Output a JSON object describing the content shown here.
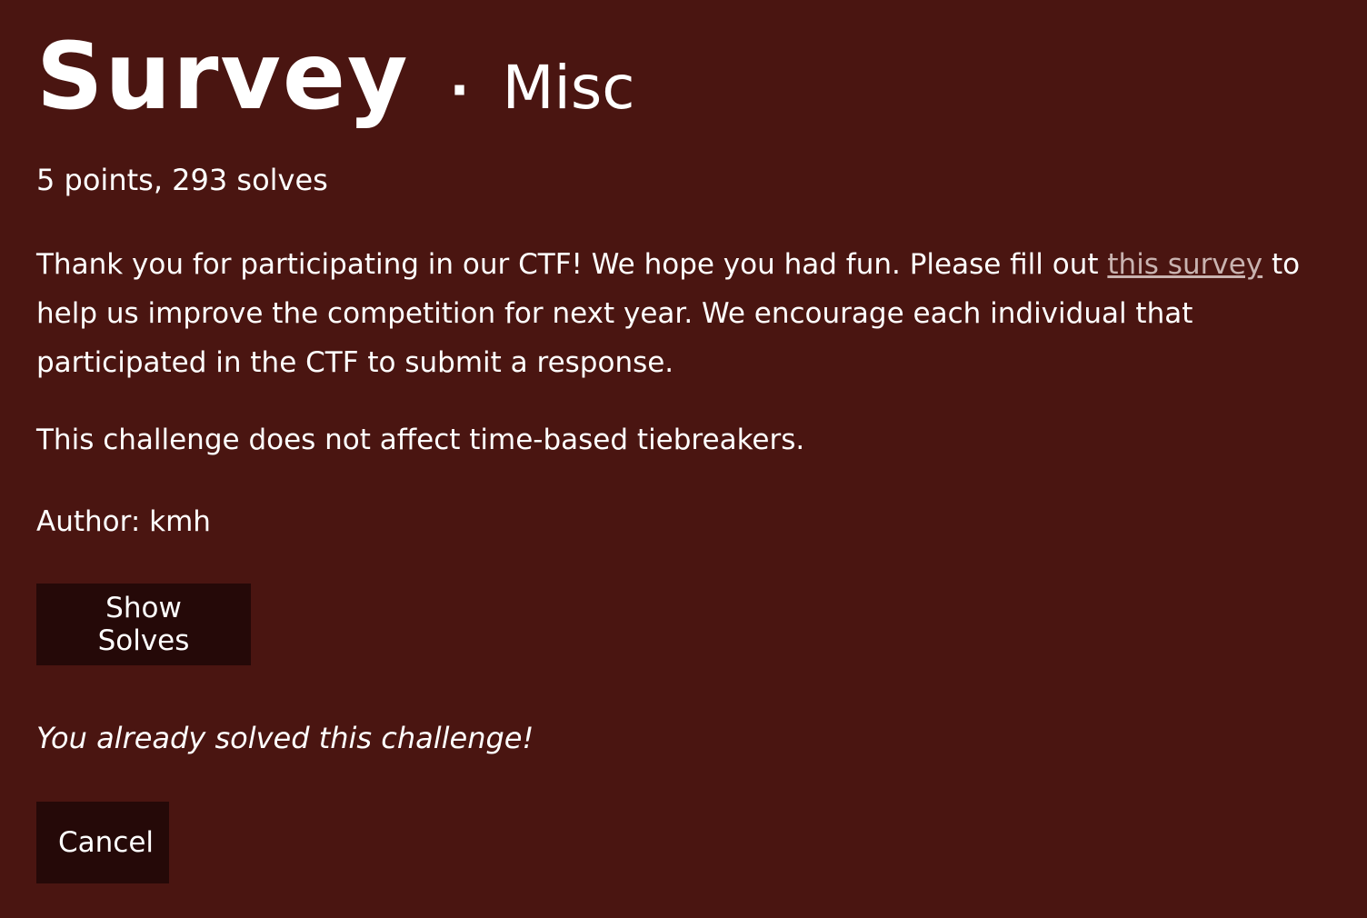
{
  "challenge": {
    "title": "Survey",
    "separator": "·",
    "category": "Misc",
    "points_solves": "5 points, 293 solves"
  },
  "description": {
    "part1": "Thank you for participating in our CTF! We hope you had fun. Please fill out ",
    "link_text": "this survey",
    "part2": " to help us improve the competition for next year. We encourage each individual that participated in the CTF to submit a response.",
    "tiebreak_note": "This challenge does not affect time-based tiebreakers.",
    "author": "Author: kmh"
  },
  "actions": {
    "show_solves_label": "Show Solves",
    "solved_message": "You already solved this challenge!",
    "cancel_label": "Cancel"
  },
  "colors": {
    "background": "#4a1511",
    "button_bg": "#250908",
    "link": "#c9b3b0",
    "text": "#ffffff"
  }
}
